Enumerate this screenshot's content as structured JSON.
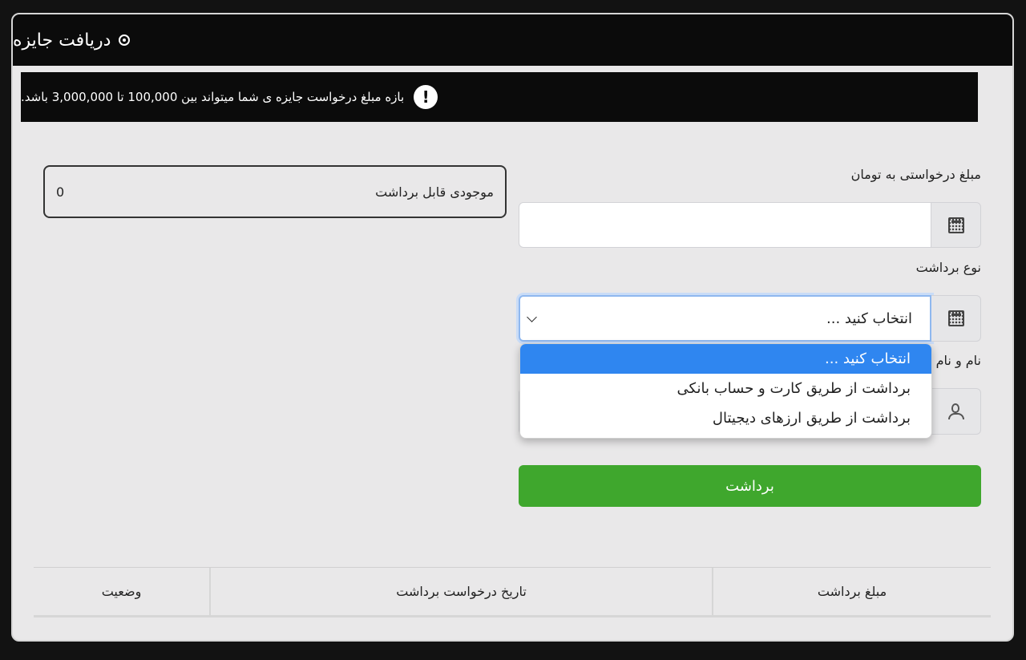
{
  "header": {
    "title": "دریافت جایزه",
    "icon": "target-icon"
  },
  "alert": {
    "icon": "exclamation-icon",
    "text": "بازه مبلغ درخواست جایزه ی شما میتواند بین 100,000 تا 3,000,000 باشد."
  },
  "form": {
    "amount_label": "مبلغ درخواستی به تومان",
    "amount_value": "",
    "type_label": "نوع برداشت",
    "type_selected": "انتخاب کنید ...",
    "type_options": [
      "انتخاب کنید ...",
      "برداشت از طریق کارت و حساب بانکی",
      "برداشت از طریق ارزهای دیجیتال"
    ],
    "name_label": "نام و نام",
    "submit_label": "برداشت"
  },
  "balance": {
    "label": "موجودی قابل برداشت",
    "value": "0"
  },
  "table": {
    "headers": [
      "مبلغ برداشت",
      "تاریخ درخواست برداشت",
      "وضعیت"
    ]
  },
  "colors": {
    "background": "#121212",
    "panel": "#e9e8e9",
    "header": "#0b0b0b",
    "accent": "#2f86f0",
    "submit": "#3fa72d"
  }
}
